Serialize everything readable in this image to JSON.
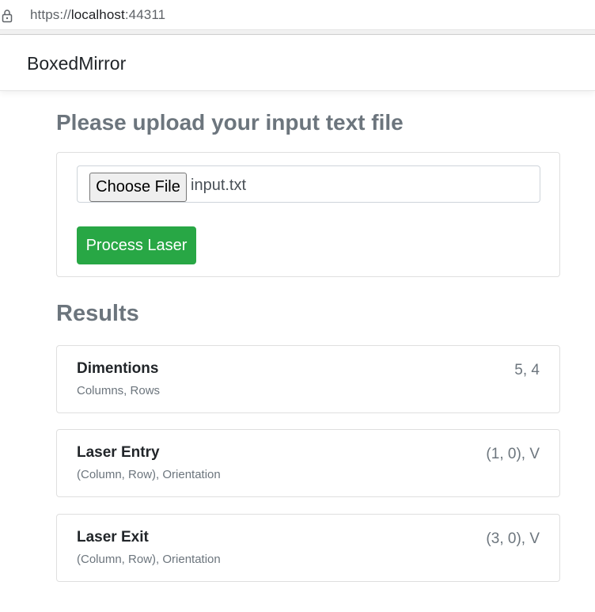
{
  "browser": {
    "url_scheme": "https://",
    "url_host": "localhost",
    "url_port": ":44311"
  },
  "navbar": {
    "brand": "BoxedMirror"
  },
  "upload": {
    "heading": "Please upload your input text file",
    "choose_file_label": "Choose File",
    "selected_file": "input.txt",
    "process_button_label": "Process Laser"
  },
  "results": {
    "heading": "Results",
    "items": [
      {
        "label": "Dimentions",
        "sublabel": "Columns, Rows",
        "value": "5, 4"
      },
      {
        "label": "Laser Entry",
        "sublabel": "(Column, Row), Orientation",
        "value": "(1, 0), V"
      },
      {
        "label": "Laser Exit",
        "sublabel": "(Column, Row), Orientation",
        "value": "(3, 0), V"
      }
    ]
  },
  "colors": {
    "primary_action": "#28a745",
    "heading_text": "#6c757d"
  }
}
